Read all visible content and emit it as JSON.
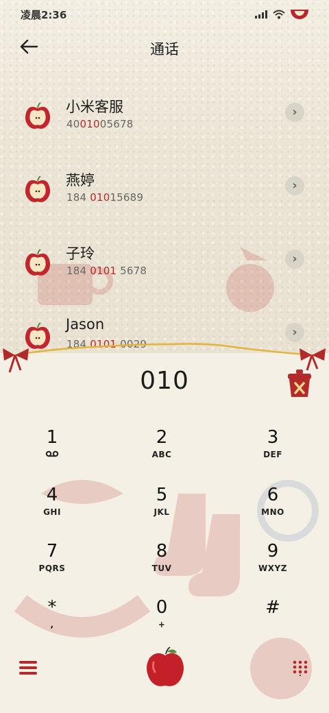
{
  "status": {
    "time": "凌晨2:36"
  },
  "header": {
    "title": "通话",
    "back_icon": "back-arrow-icon"
  },
  "contacts": [
    {
      "name": "小米客服",
      "num_pre": "40",
      "num_hl": "010",
      "num_post": "05678"
    },
    {
      "name": "燕婷",
      "num_pre": "184 ",
      "num_hl": "010",
      "num_post": "15689"
    },
    {
      "name": "子玲",
      "num_pre": "184 ",
      "num_hl": "0101",
      "num_post": " 5678"
    },
    {
      "name": "Jason",
      "num_pre": "184 ",
      "num_hl": "0101",
      "num_post": " 0029"
    }
  ],
  "dial": {
    "input": "010"
  },
  "keys": [
    {
      "digit": "1",
      "letters": ""
    },
    {
      "digit": "2",
      "letters": "ABC"
    },
    {
      "digit": "3",
      "letters": "DEF"
    },
    {
      "digit": "4",
      "letters": "GHI"
    },
    {
      "digit": "5",
      "letters": "JKL"
    },
    {
      "digit": "6",
      "letters": "MNO"
    },
    {
      "digit": "7",
      "letters": "PQRS"
    },
    {
      "digit": "8",
      "letters": "TUV"
    },
    {
      "digit": "9",
      "letters": "WXYZ"
    },
    {
      "digit": "*",
      "letters": ","
    },
    {
      "digit": "0",
      "letters": "+"
    },
    {
      "digit": "#",
      "letters": ""
    }
  ],
  "colors": {
    "accent": "#b22a2a",
    "background": "#f4efe4"
  },
  "bottom": {
    "menu_icon": "menu-icon",
    "call_icon": "apple-call-icon",
    "dialpad_icon": "dialpad-icon"
  }
}
